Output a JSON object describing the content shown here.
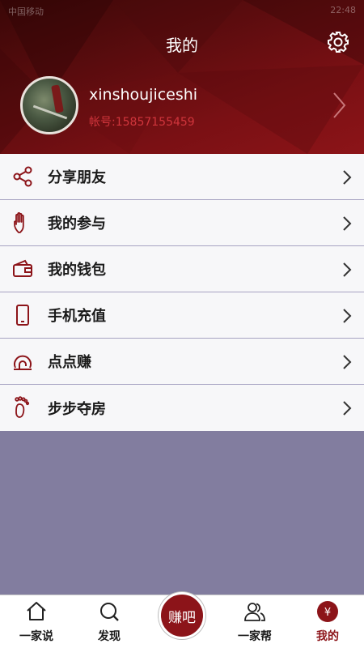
{
  "status_bar": {
    "left": "中国移动",
    "right": "22:48"
  },
  "header": {
    "title": "我的",
    "settings_icon": "gear-icon",
    "user_name": "xinshoujiceshi",
    "account": "帐号:15857155459",
    "accent_color": "#8c1419"
  },
  "menu": {
    "items": [
      {
        "label": "分享朋友",
        "icon": "share-icon"
      },
      {
        "label": "我的参与",
        "icon": "hand-icon"
      },
      {
        "label": "我的钱包",
        "icon": "wallet-icon"
      },
      {
        "label": "手机充值",
        "icon": "phone-icon"
      },
      {
        "label": "点点赚",
        "icon": "touch-icon"
      },
      {
        "label": "步步夺房",
        "icon": "footprint-icon"
      }
    ]
  },
  "tabbar": {
    "tabs": [
      {
        "label": "一家说",
        "icon": "home-icon"
      },
      {
        "label": "发现",
        "icon": "search-icon"
      },
      {
        "label": "一家帮",
        "icon": "users-icon"
      },
      {
        "label": "我的",
        "icon": "yen-icon",
        "active": true
      }
    ],
    "center_label": "赚吧"
  }
}
